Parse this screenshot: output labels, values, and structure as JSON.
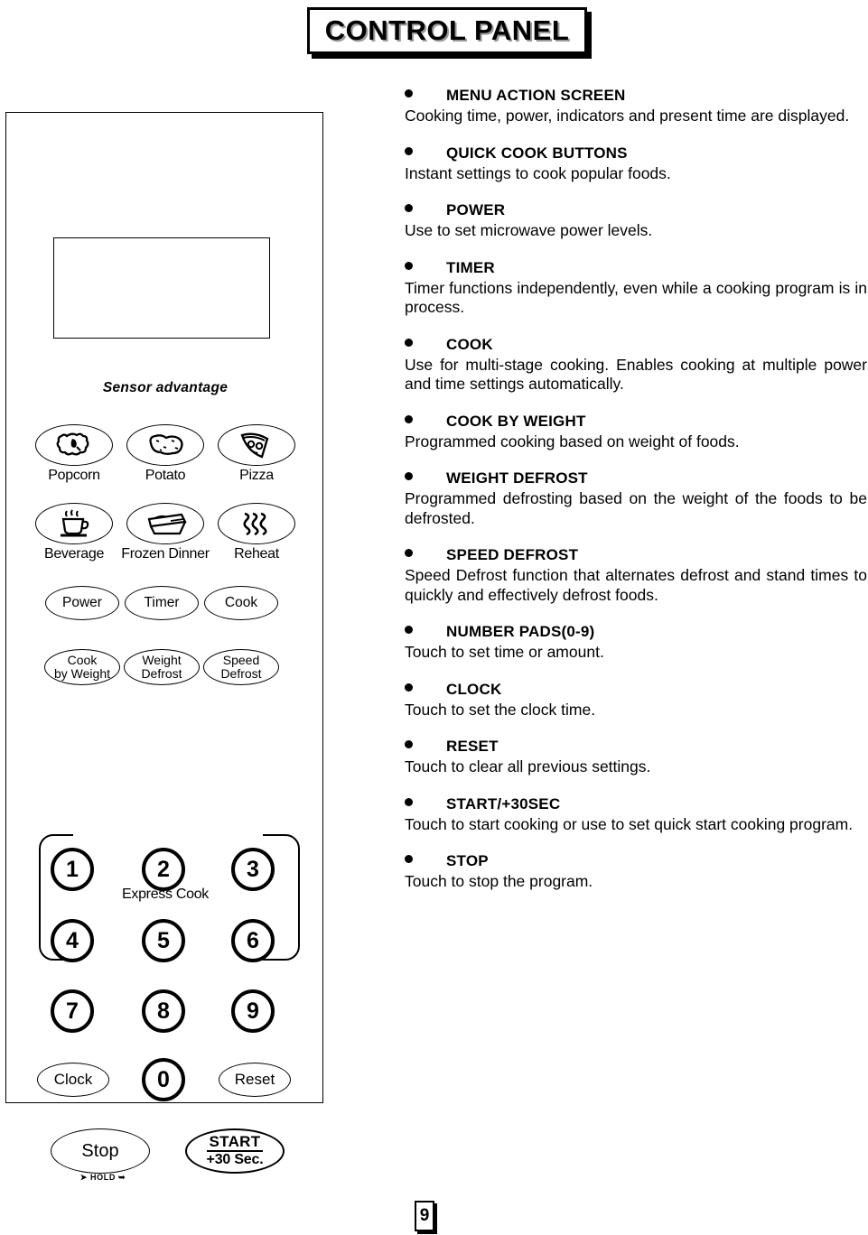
{
  "title": "CONTROL PANEL",
  "page_number": "9",
  "panel": {
    "sensor_section_title": "Sensor advantage",
    "sensor_buttons": [
      {
        "label": "Popcorn",
        "icon": "popcorn-icon"
      },
      {
        "label": "Potato",
        "icon": "potato-icon"
      },
      {
        "label": "Pizza",
        "icon": "pizza-icon"
      },
      {
        "label": "Beverage",
        "icon": "beverage-cup-icon"
      },
      {
        "label": "Frozen Dinner",
        "icon": "frozen-dinner-tray-icon"
      },
      {
        "label": "Reheat",
        "icon": "reheat-waves-icon"
      }
    ],
    "function_buttons": [
      {
        "label": "Power"
      },
      {
        "label": "Timer"
      },
      {
        "label": "Cook"
      }
    ],
    "weight_buttons": [
      {
        "line1": "Cook",
        "line2": "by Weight"
      },
      {
        "line1": "Weight",
        "line2": "Defrost"
      },
      {
        "line1": "Speed",
        "line2": "Defrost"
      }
    ],
    "express_cook_label": "Express Cook",
    "number_pads": [
      "1",
      "2",
      "3",
      "4",
      "5",
      "6",
      "7",
      "8",
      "9",
      "0"
    ],
    "clock_button": "Clock",
    "reset_button": "Reset",
    "stop_button": "Stop",
    "hold_label": "HOLD",
    "start_button": {
      "top": "START",
      "bottom": "+30 Sec."
    }
  },
  "descriptions": [
    {
      "heading": "MENU ACTION SCREEN",
      "body": "Cooking time, power, indicators and present time are displayed."
    },
    {
      "heading": "QUICK COOK BUTTONS",
      "body": "Instant settings to cook popular foods."
    },
    {
      "heading": "POWER",
      "body": "Use to set microwave power levels."
    },
    {
      "heading": "TIMER",
      "body": "Timer functions independently, even while a cooking program is in process."
    },
    {
      "heading": "COOK",
      "body": "Use for multi-stage cooking. Enables cooking at multiple power and time settings automatically."
    },
    {
      "heading": "COOK BY WEIGHT",
      "body": "Programmed cooking based on weight of foods."
    },
    {
      "heading": "WEIGHT DEFROST",
      "body": "Programmed defrosting based on the weight of the foods to be defrosted."
    },
    {
      "heading": "SPEED DEFROST",
      "body": "Speed Defrost function that alternates defrost and stand times to quickly and effectively defrost foods."
    },
    {
      "heading": "NUMBER PADS(0-9)",
      "body": "Touch to set time or amount."
    },
    {
      "heading": "CLOCK",
      "body": "Touch to set the clock time."
    },
    {
      "heading": "RESET",
      "body": "Touch to clear all previous settings."
    },
    {
      "heading": "START/+30SEC",
      "body": "Touch to start cooking or use to set quick start cooking program."
    },
    {
      "heading": "STOP",
      "body": "Touch to stop the program."
    }
  ]
}
